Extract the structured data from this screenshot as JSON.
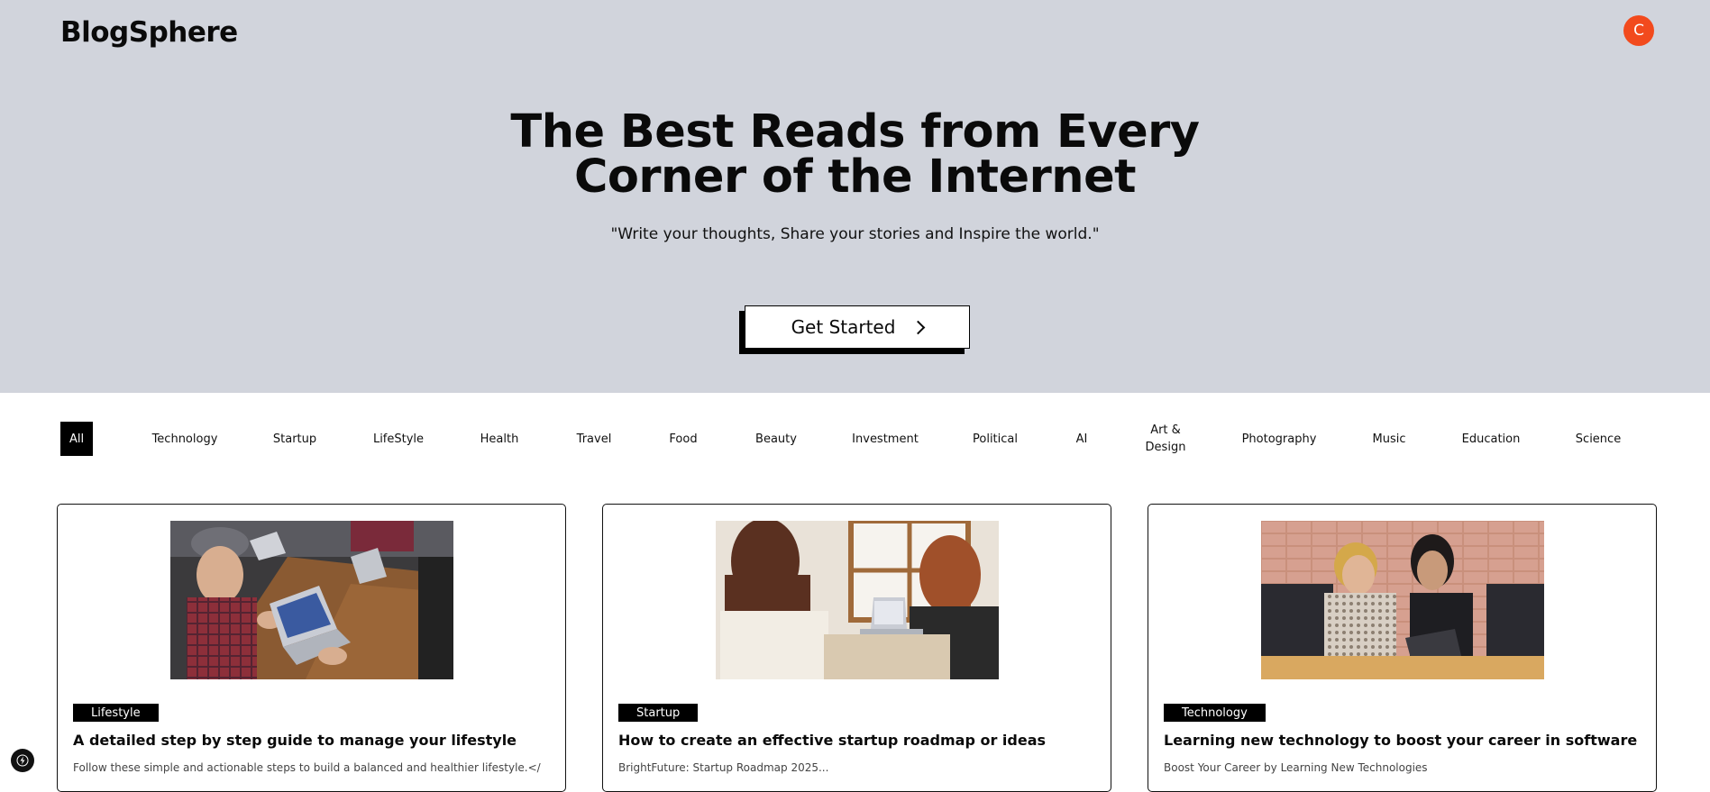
{
  "header": {
    "logo": "BlogSphere",
    "avatar_letter": "C"
  },
  "hero": {
    "title_line1": "The Best Reads from Every",
    "title_line2": "Corner of the Internet",
    "subtitle": "\"Write your thoughts, Share your stories and Inspire the world.\"",
    "cta_label": "Get Started",
    "cta_icon": "chevron-right-icon"
  },
  "categories": {
    "items": [
      "All",
      "Technology",
      "Startup",
      "LifeStyle",
      "Health",
      "Travel",
      "Food",
      "Beauty",
      "Investment",
      "Political",
      "AI",
      "Art &\nDesign",
      "Photography",
      "Music",
      "Education",
      "Science"
    ],
    "active": "All"
  },
  "posts": [
    {
      "category": "Lifestyle",
      "title": "A detailed step by step guide to manage your lifestyle",
      "excerpt": "Follow these simple and actionable steps to build a balanced and healthier lifestyle.</"
    },
    {
      "category": "Startup",
      "title": "How to create an effective startup roadmap or ideas",
      "excerpt": "BrightFuture: Startup Roadmap 2025..."
    },
    {
      "category": "Technology",
      "title": "Learning new technology to boost your career in software",
      "excerpt": "Boost Your Career by Learning New Technologies"
    }
  ],
  "colors": {
    "hero_bg": "#d1d4dc",
    "avatar_bg": "#f24a1d",
    "accent": "#000000"
  },
  "dev_tools_icon": "lightning-icon"
}
